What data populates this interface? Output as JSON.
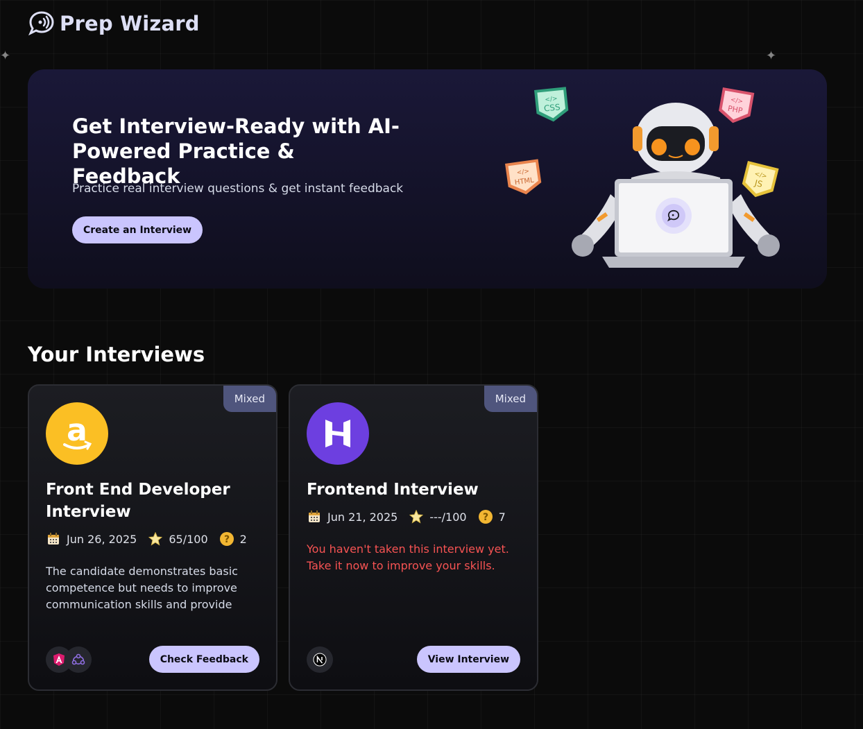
{
  "app": {
    "brand": "Prep Wizard",
    "brand_icon": "chat-bubble-logo-icon"
  },
  "hero": {
    "title": "Get Interview-Ready with AI-Powered Practice & Feedback",
    "subtitle": "Practice real interview questions & get instant feedback",
    "cta_label": "Create an Interview",
    "illustration_tags": [
      "CSS",
      "PHP",
      "HTML",
      "JS"
    ]
  },
  "section": {
    "title": "Your Interviews"
  },
  "interviews": [
    {
      "type": "Mixed",
      "cover": "amazon-logo-icon",
      "role": "Front End Developer Interview",
      "date": "Jun 26, 2025",
      "score": "65/100",
      "questions": "2",
      "description": "The candidate demonstrates basic competence but needs to improve communication skills and provide more detailed and thorough answers. Further practice will help.",
      "tech_icons": [
        "angular-icon",
        "redux-icon"
      ],
      "button_label": "Check Feedback"
    },
    {
      "type": "Mixed",
      "cover": "hostinger-logo-icon",
      "role": "Frontend Interview",
      "date": "Jun 21, 2025",
      "score": "---/100",
      "questions": "7",
      "description": "You haven't taken this interview yet. Take it now to improve your skills.",
      "tech_icons": [
        "nextjs-icon"
      ],
      "button_label": "View Interview"
    }
  ],
  "colors": {
    "background": "#0b0b0b",
    "accent": "#cac5fe",
    "badge": "#4f557d",
    "warning_text": "#f75353",
    "amazon": "#fbbf24",
    "hostinger": "#6d3fe0"
  }
}
